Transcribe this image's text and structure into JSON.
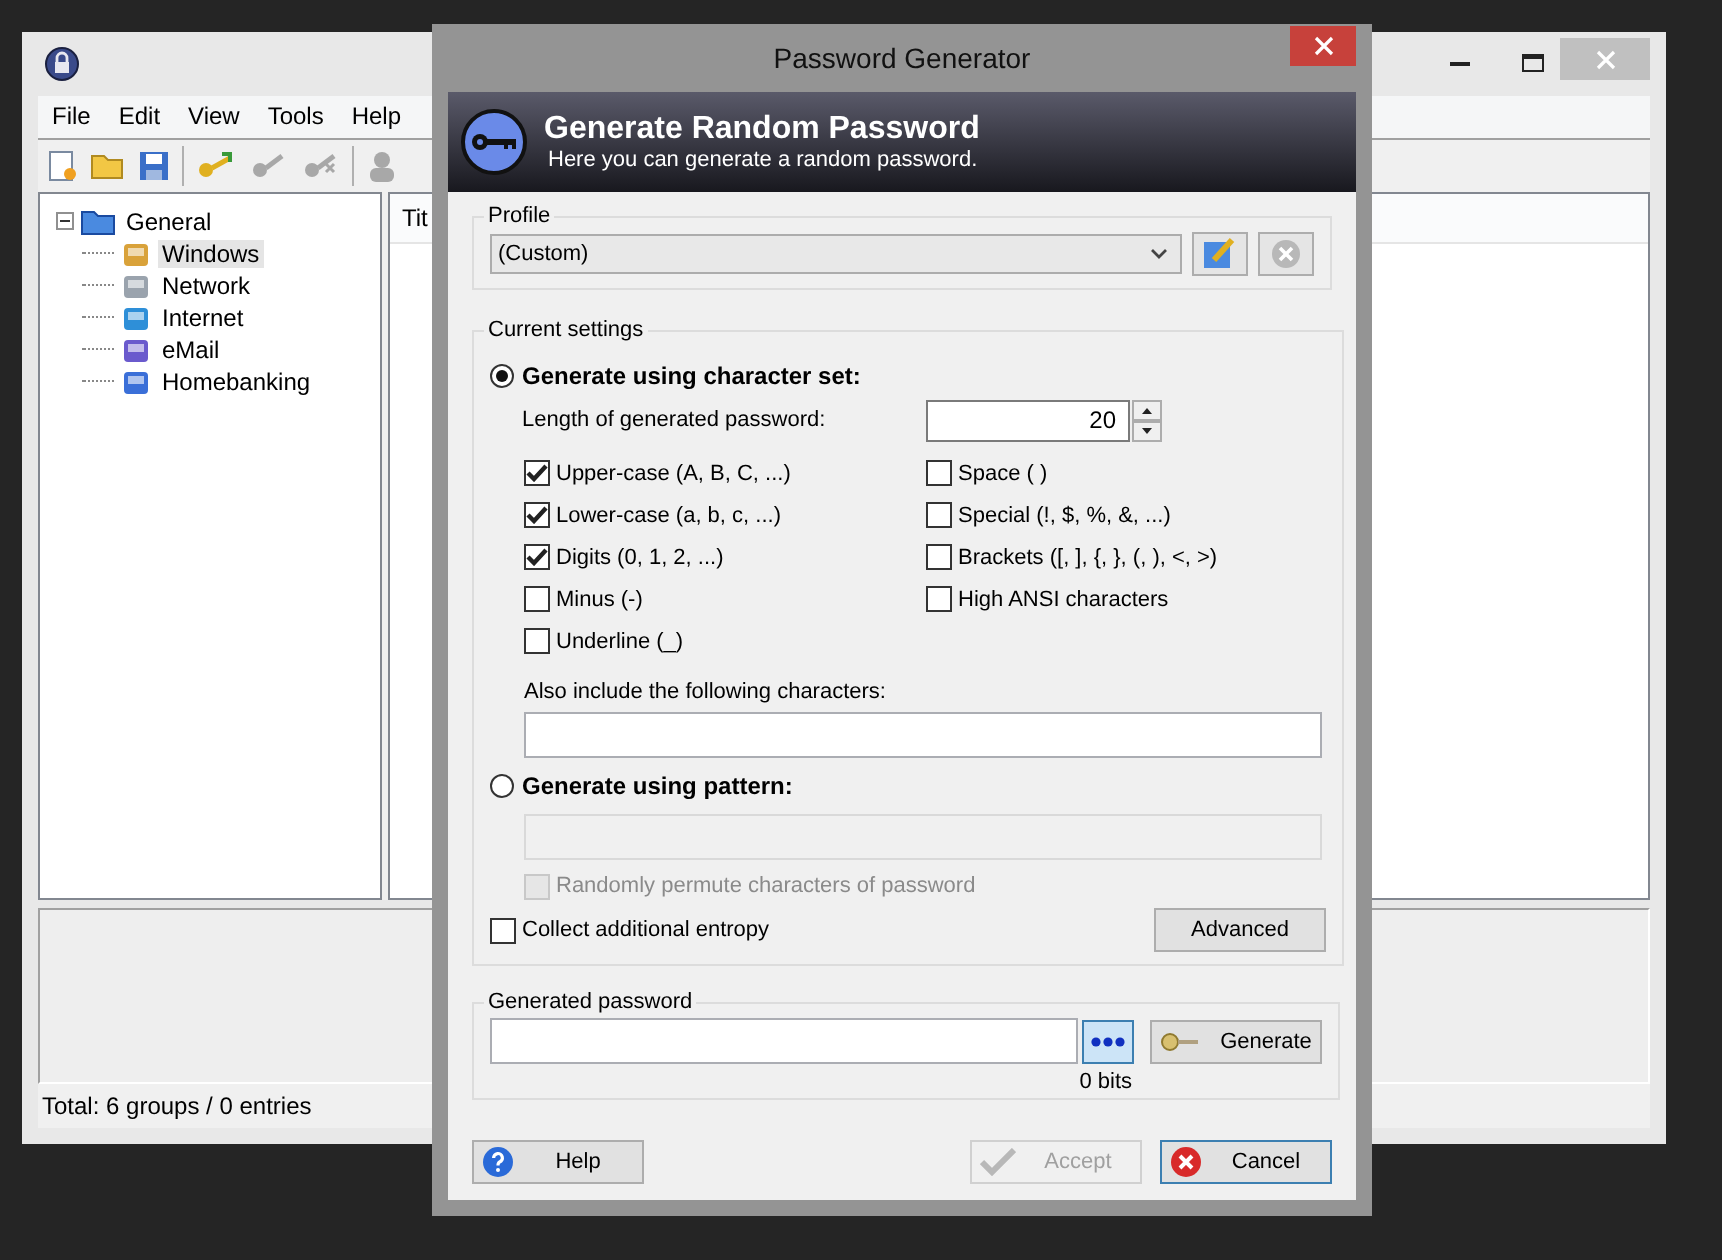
{
  "main_window": {
    "menu": [
      "File",
      "Edit",
      "View",
      "Tools",
      "Help"
    ],
    "tree": {
      "label": "General",
      "expanded": true,
      "children": [
        {
          "label": "Windows",
          "selected": true
        },
        {
          "label": "Network",
          "selected": false
        },
        {
          "label": "Internet",
          "selected": false
        },
        {
          "label": "eMail",
          "selected": false
        },
        {
          "label": "Homebanking",
          "selected": false
        }
      ]
    },
    "list_header": "Tit",
    "status_bar": "Total: 6 groups / 0 entries"
  },
  "dialog": {
    "title": "Password Generator",
    "banner": {
      "title": "Generate Random Password",
      "subtitle": "Here you can generate a random password."
    },
    "profile": {
      "legend": "Profile",
      "value": "(Custom)"
    },
    "settings": {
      "legend": "Current settings",
      "charset_mode": {
        "label": "Generate using character set:",
        "selected": true
      },
      "length": {
        "label": "Length of generated password:",
        "value": "20"
      },
      "options": [
        {
          "label": "Upper-case (A, B, C, ...)",
          "checked": true
        },
        {
          "label": "Lower-case (a, b, c, ...)",
          "checked": true
        },
        {
          "label": "Digits (0, 1, 2, ...)",
          "checked": true
        },
        {
          "label": "Minus (-)",
          "checked": false
        },
        {
          "label": "Underline (_)",
          "checked": false
        },
        {
          "label": "Space ( )",
          "checked": false
        },
        {
          "label": "Special (!, $, %, &, ...)",
          "checked": false
        },
        {
          "label": "Brackets ([, ], {, }, (, ), <, >)",
          "checked": false
        },
        {
          "label": "High ANSI characters",
          "checked": false
        }
      ],
      "also_include": {
        "label": "Also include the following characters:"
      },
      "pattern_mode": {
        "label": "Generate using pattern:",
        "selected": false
      },
      "permute": {
        "label": "Randomly permute characters of password",
        "checked": false,
        "disabled": true
      },
      "entropy": {
        "label": "Collect additional entropy",
        "checked": false
      },
      "advanced_button": "Advanced"
    },
    "generated": {
      "legend": "Generated password",
      "generate_button": "Generate",
      "bits": "0 bits"
    },
    "buttons": [
      {
        "label": "Help",
        "kind": "help",
        "disabled": false
      },
      {
        "label": "Accept",
        "kind": "accept",
        "disabled": true
      },
      {
        "label": "Cancel",
        "kind": "cancel",
        "disabled": false
      }
    ]
  }
}
